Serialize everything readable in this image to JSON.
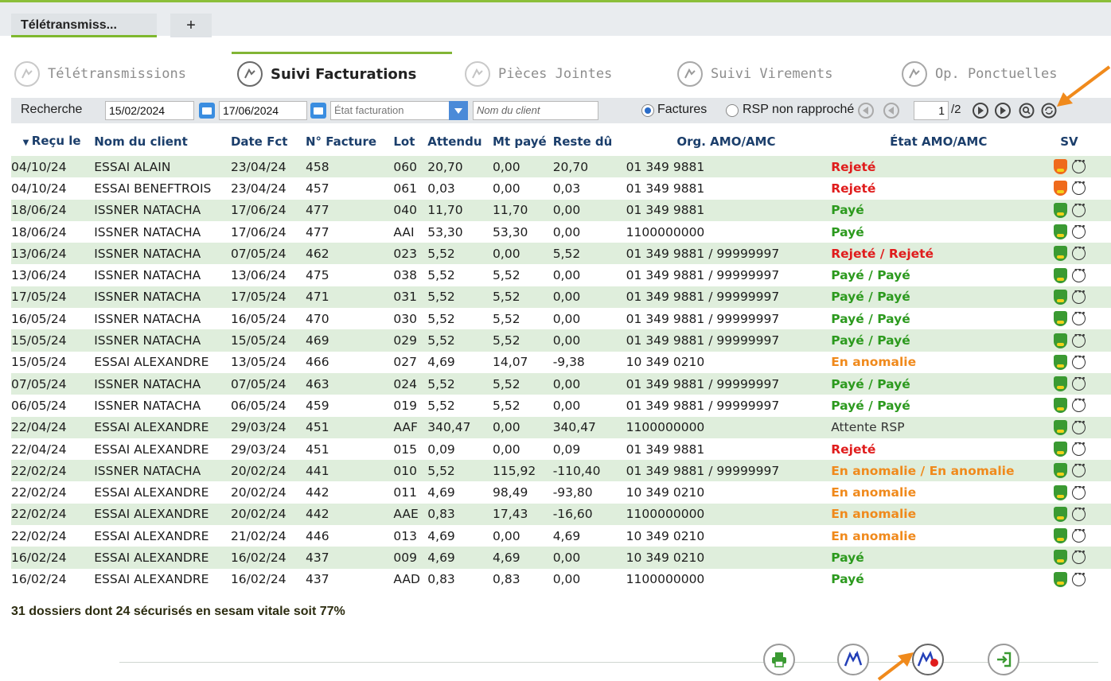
{
  "tabs": {
    "active": "Télétransmiss...",
    "add": "+"
  },
  "nav": {
    "items": [
      {
        "label": "Télétransmissions"
      },
      {
        "label": "Suivi Facturations"
      },
      {
        "label": "Pièces Jointes"
      },
      {
        "label": "Suivi Virements"
      },
      {
        "label": "Op. Ponctuelles"
      }
    ]
  },
  "search": {
    "label": "Recherche",
    "date_from": "15/02/2024",
    "date_to": "17/06/2024",
    "etat_placeholder": "État facturation",
    "client_placeholder": "Nom du client",
    "radio_factures": "Factures",
    "radio_rsp": "RSP non rapproché",
    "page_current": "1",
    "page_total": "/2"
  },
  "table": {
    "headers": [
      "Reçu le",
      "Nom du client",
      "Date Fct",
      "N° Facture",
      "Lot",
      "Attendu",
      "Mt payé",
      "Reste dû",
      "Org. AMO/AMC",
      "État AMO/AMC",
      "SV"
    ],
    "rows": [
      [
        "04/10/24",
        "ESSAI ALAIN",
        "23/04/24",
        "458",
        "060",
        "20,70",
        "0,00",
        "20,70",
        "01 349 9881",
        "Rejeté",
        "deo"
      ],
      [
        "04/10/24",
        "ESSAI BENEFTROIS",
        "23/04/24",
        "457",
        "061",
        "0,03",
        "0,00",
        "0,03",
        "01 349 9881",
        "Rejeté",
        "deo"
      ],
      [
        "18/06/24",
        "ISSNER NATACHA",
        "17/06/24",
        "477",
        "040",
        "11,70",
        "11,70",
        "0,00",
        "01 349 9881",
        "Payé",
        "sv"
      ],
      [
        "18/06/24",
        "ISSNER NATACHA",
        "17/06/24",
        "477",
        "AAI",
        "53,30",
        "53,30",
        "0,00",
        "1100000000",
        "Payé",
        "sv"
      ],
      [
        "13/06/24",
        "ISSNER NATACHA",
        "07/05/24",
        "462",
        "023",
        "5,52",
        "0,00",
        "5,52",
        "01 349 9881 / 99999997",
        "Rejeté / Rejeté",
        "sv"
      ],
      [
        "13/06/24",
        "ISSNER NATACHA",
        "13/06/24",
        "475",
        "038",
        "5,52",
        "5,52",
        "0,00",
        "01 349 9881 / 99999997",
        "Payé / Payé",
        "sv"
      ],
      [
        "17/05/24",
        "ISSNER NATACHA",
        "17/05/24",
        "471",
        "031",
        "5,52",
        "5,52",
        "0,00",
        "01 349 9881 / 99999997",
        "Payé / Payé",
        "sv"
      ],
      [
        "16/05/24",
        "ISSNER NATACHA",
        "16/05/24",
        "470",
        "030",
        "5,52",
        "5,52",
        "0,00",
        "01 349 9881 / 99999997",
        "Payé / Payé",
        "sv"
      ],
      [
        "15/05/24",
        "ISSNER NATACHA",
        "15/05/24",
        "469",
        "029",
        "5,52",
        "5,52",
        "0,00",
        "01 349 9881 / 99999997",
        "Payé / Payé",
        "sv"
      ],
      [
        "15/05/24",
        "ESSAI ALEXANDRE",
        "13/05/24",
        "466",
        "027",
        "4,69",
        "14,07",
        "-9,38",
        "10 349 0210",
        "En anomalie",
        "sv"
      ],
      [
        "07/05/24",
        "ISSNER NATACHA",
        "07/05/24",
        "463",
        "024",
        "5,52",
        "5,52",
        "0,00",
        "01 349 9881 / 99999997",
        "Payé / Payé",
        "sv"
      ],
      [
        "06/05/24",
        "ISSNER NATACHA",
        "06/05/24",
        "459",
        "019",
        "5,52",
        "5,52",
        "0,00",
        "01 349 9881 / 99999997",
        "Payé / Payé",
        "sv"
      ],
      [
        "22/04/24",
        "ESSAI ALEXANDRE",
        "29/03/24",
        "451",
        "AAF",
        "340,47",
        "0,00",
        "340,47",
        "1100000000",
        "Attente RSP",
        "sv"
      ],
      [
        "22/04/24",
        "ESSAI ALEXANDRE",
        "29/03/24",
        "451",
        "015",
        "0,09",
        "0,00",
        "0,09",
        "01 349 9881",
        "Rejeté",
        "sv"
      ],
      [
        "22/02/24",
        "ISSNER NATACHA",
        "20/02/24",
        "441",
        "010",
        "5,52",
        "115,92",
        "-110,40",
        "01 349 9881 / 99999997",
        "En anomalie / En anomalie",
        "sv"
      ],
      [
        "22/02/24",
        "ESSAI ALEXANDRE",
        "20/02/24",
        "442",
        "011",
        "4,69",
        "98,49",
        "-93,80",
        "10 349 0210",
        "En anomalie",
        "sv"
      ],
      [
        "22/02/24",
        "ESSAI ALEXANDRE",
        "20/02/24",
        "442",
        "AAE",
        "0,83",
        "17,43",
        "-16,60",
        "1100000000",
        "En anomalie",
        "sv"
      ],
      [
        "22/02/24",
        "ESSAI ALEXANDRE",
        "21/02/24",
        "446",
        "013",
        "4,69",
        "0,00",
        "4,69",
        "10 349 0210",
        "En anomalie",
        "sv"
      ],
      [
        "16/02/24",
        "ESSAI ALEXANDRE",
        "16/02/24",
        "437",
        "009",
        "4,69",
        "4,69",
        "0,00",
        "10 349 0210",
        "Payé",
        "sv"
      ],
      [
        "16/02/24",
        "ESSAI ALEXANDRE",
        "16/02/24",
        "437",
        "AAD",
        "0,83",
        "0,83",
        "0,00",
        "1100000000",
        "Payé",
        "sv"
      ]
    ]
  },
  "summary": "31 dossiers dont 24 sécurisés en sesam vitale soit 77%",
  "colors": {
    "accent": "#7fb82e",
    "rejected": "#e01c1c",
    "paid": "#2c9a1e",
    "anomaly": "#f08a1c",
    "annotation_arrow": "#f08a1c"
  },
  "footer_icons": [
    "printer-icon",
    "teletransmit-icon",
    "teletransmit-alert-icon",
    "exit-icon"
  ]
}
